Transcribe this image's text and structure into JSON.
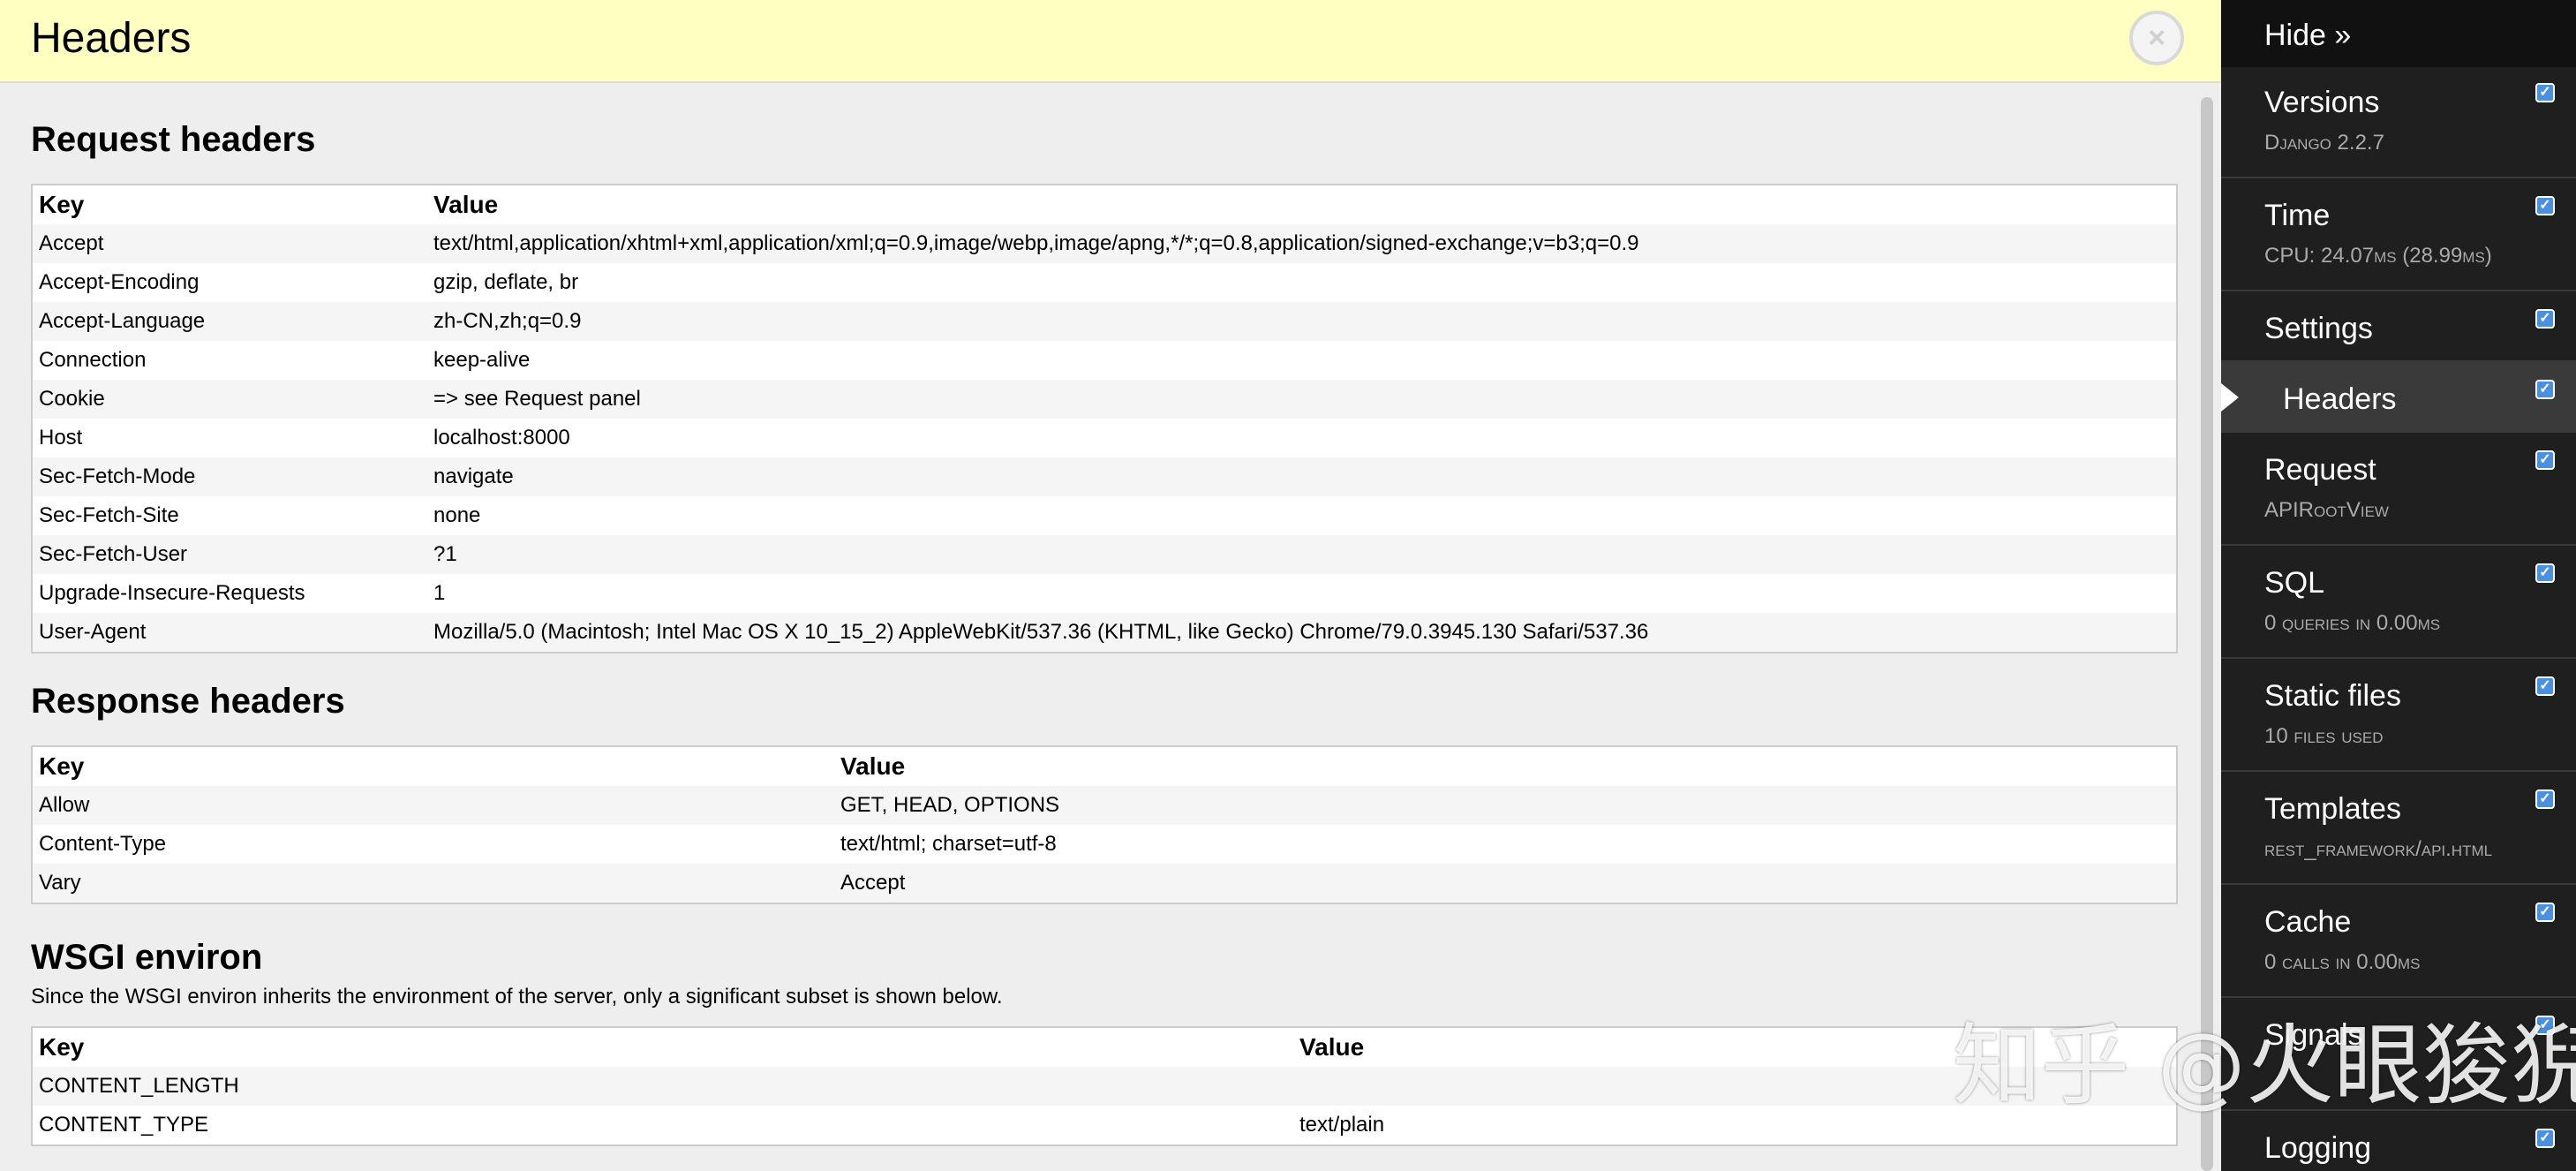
{
  "panel": {
    "title": "Headers",
    "close_icon": "close-circle-icon",
    "request_headers": {
      "heading": "Request headers",
      "columns": [
        "Key",
        "Value"
      ],
      "rows": [
        [
          "Accept",
          "text/html,application/xhtml+xml,application/xml;q=0.9,image/webp,image/apng,*/*;q=0.8,application/signed-exchange;v=b3;q=0.9"
        ],
        [
          "Accept-Encoding",
          "gzip, deflate, br"
        ],
        [
          "Accept-Language",
          "zh-CN,zh;q=0.9"
        ],
        [
          "Connection",
          "keep-alive"
        ],
        [
          "Cookie",
          "=> see Request panel"
        ],
        [
          "Host",
          "localhost:8000"
        ],
        [
          "Sec-Fetch-Mode",
          "navigate"
        ],
        [
          "Sec-Fetch-Site",
          "none"
        ],
        [
          "Sec-Fetch-User",
          "?1"
        ],
        [
          "Upgrade-Insecure-Requests",
          "1"
        ],
        [
          "User-Agent",
          "Mozilla/5.0 (Macintosh; Intel Mac OS X 10_15_2) AppleWebKit/537.36 (KHTML, like Gecko) Chrome/79.0.3945.130 Safari/537.36"
        ]
      ]
    },
    "response_headers": {
      "heading": "Response headers",
      "columns": [
        "Key",
        "Value"
      ],
      "rows": [
        [
          "Allow",
          "GET, HEAD, OPTIONS"
        ],
        [
          "Content-Type",
          "text/html; charset=utf-8"
        ],
        [
          "Vary",
          "Accept"
        ]
      ]
    },
    "wsgi_environ": {
      "heading": "WSGI environ",
      "note": "Since the WSGI environ inherits the environment of the server, only a significant subset is shown below.",
      "columns": [
        "Key",
        "Value"
      ],
      "rows": [
        [
          "CONTENT_LENGTH",
          ""
        ],
        [
          "CONTENT_TYPE",
          "text/plain"
        ]
      ]
    }
  },
  "toolbar": {
    "hide_label": "Hide »",
    "items": [
      {
        "title": "Versions",
        "subtitle": "Django 2.2.7",
        "checked": true,
        "active": false
      },
      {
        "title": "Time",
        "subtitle": "CPU: 24.07ms (28.99ms)",
        "checked": true,
        "active": false
      },
      {
        "title": "Settings",
        "subtitle": "",
        "checked": true,
        "active": false
      },
      {
        "title": "Headers",
        "subtitle": "",
        "checked": true,
        "active": true
      },
      {
        "title": "Request",
        "subtitle": "APIRootView",
        "checked": true,
        "active": false
      },
      {
        "title": "SQL",
        "subtitle": "0 queries in 0.00ms",
        "checked": true,
        "active": false
      },
      {
        "title": "Static files",
        "subtitle": "10 files used",
        "checked": true,
        "active": false
      },
      {
        "title": "Templates",
        "subtitle": "rest_framework/api.html",
        "checked": true,
        "active": false
      },
      {
        "title": "Cache",
        "subtitle": "0 calls in 0.00ms",
        "checked": true,
        "active": false
      },
      {
        "title": "Signals",
        "subtitle": "",
        "checked": true,
        "active": false
      },
      {
        "title": "Logging",
        "subtitle": "",
        "checked": true,
        "active": false
      }
    ]
  },
  "watermark": "知乎 @火眼狻猊",
  "colors": {
    "header_bg": "#ffffc2",
    "toolbar_bg": "#1f1f1f",
    "checkbox": "#4a90e2"
  }
}
